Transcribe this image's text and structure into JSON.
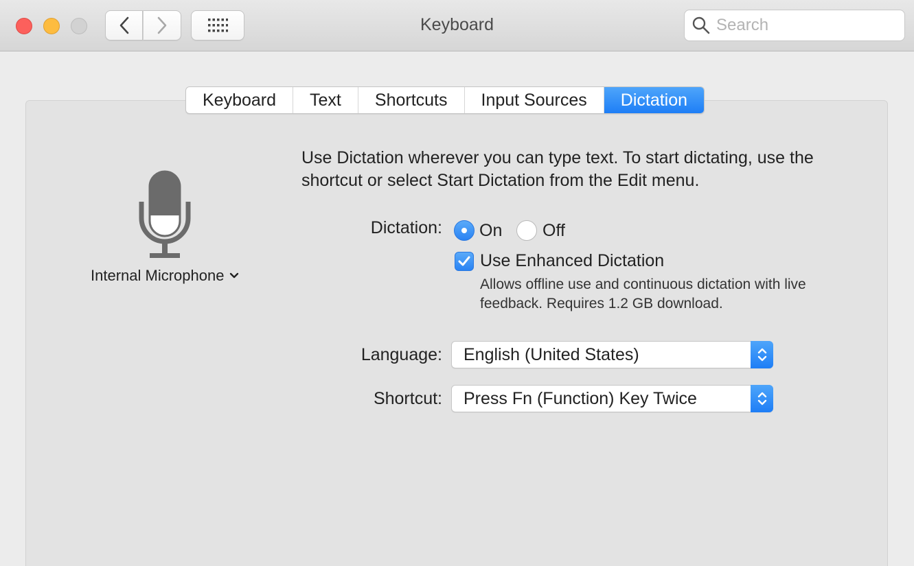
{
  "window": {
    "title": "Keyboard",
    "search_placeholder": "Search"
  },
  "tabs": [
    {
      "label": "Keyboard",
      "active": false
    },
    {
      "label": "Text",
      "active": false
    },
    {
      "label": "Shortcuts",
      "active": false
    },
    {
      "label": "Input Sources",
      "active": false
    },
    {
      "label": "Dictation",
      "active": true
    }
  ],
  "microphone": {
    "label": "Internal Microphone",
    "icon": "microphone-icon"
  },
  "dictation": {
    "description": "Use Dictation wherever you can type text. To start dictating, use the shortcut or select Start Dictation from the Edit menu.",
    "label": "Dictation:",
    "on_label": "On",
    "off_label": "Off",
    "selected": "On",
    "enhanced_label": "Use Enhanced Dictation",
    "enhanced_checked": true,
    "enhanced_help": "Allows offline use and continuous dictation with live feedback. Requires 1.2 GB download."
  },
  "language": {
    "label": "Language:",
    "value": "English (United States)"
  },
  "shortcut": {
    "label": "Shortcut:",
    "value": "Press Fn (Function) Key Twice"
  },
  "colors": {
    "accent": "#2a83f3",
    "close": "#fc605c",
    "minimize": "#fdbc40",
    "zoom_disabled": "#d2d2d2"
  }
}
